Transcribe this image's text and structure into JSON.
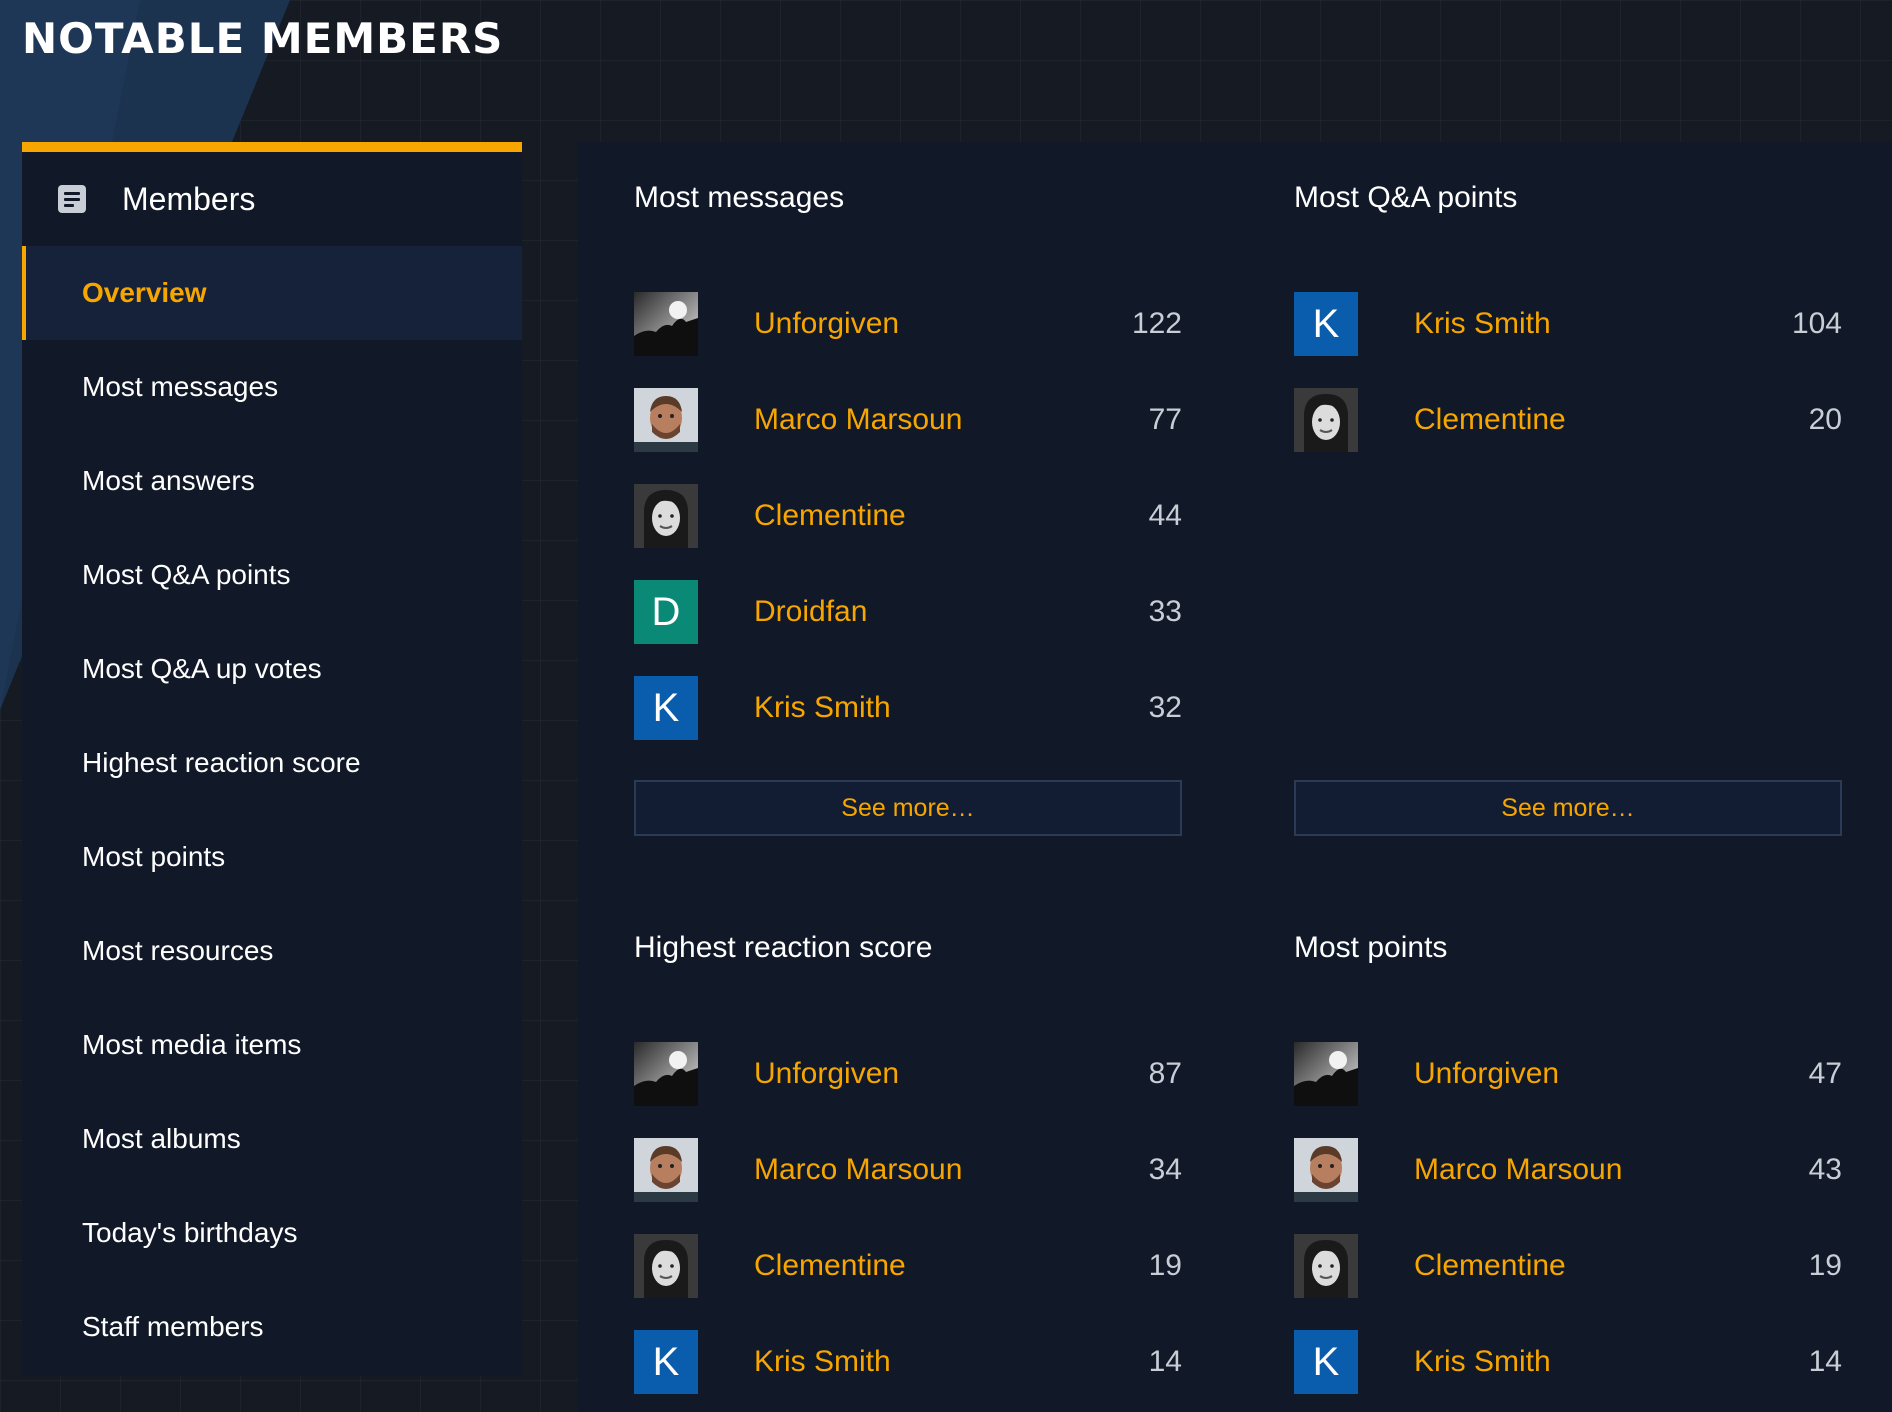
{
  "page": {
    "title": "NOTABLE MEMBERS"
  },
  "sidebar": {
    "title": "Members",
    "icon": "list-icon",
    "items": [
      {
        "label": "Overview",
        "active": true
      },
      {
        "label": "Most messages"
      },
      {
        "label": "Most answers"
      },
      {
        "label": "Most Q&A points"
      },
      {
        "label": "Most Q&A up votes"
      },
      {
        "label": "Highest reaction score"
      },
      {
        "label": "Most points"
      },
      {
        "label": "Most resources"
      },
      {
        "label": "Most media items"
      },
      {
        "label": "Most albums"
      },
      {
        "label": "Today's birthdays"
      },
      {
        "label": "Staff members"
      }
    ]
  },
  "colors": {
    "accent": "#f7a600",
    "background": "#151a23",
    "panel": "#111827",
    "avatar_d": "#0a8a76",
    "avatar_k": "#0a5cad"
  },
  "blocks": [
    {
      "title": "Most messages",
      "see_more": "See more…",
      "members": [
        {
          "name": "Unforgiven",
          "value": "122",
          "avatar": "photo-silhouette"
        },
        {
          "name": "Marco Marsoun",
          "value": "77",
          "avatar": "photo-man"
        },
        {
          "name": "Clementine",
          "value": "44",
          "avatar": "photo-woman"
        },
        {
          "name": "Droidfan",
          "value": "33",
          "avatar": "letter",
          "letter": "D",
          "color": "#0a8a76"
        },
        {
          "name": "Kris Smith",
          "value": "32",
          "avatar": "letter",
          "letter": "K",
          "color": "#0a5cad"
        }
      ]
    },
    {
      "title": "Most Q&A points",
      "see_more": "See more…",
      "members": [
        {
          "name": "Kris Smith",
          "value": "104",
          "avatar": "letter",
          "letter": "K",
          "color": "#0a5cad"
        },
        {
          "name": "Clementine",
          "value": "20",
          "avatar": "photo-woman"
        }
      ]
    },
    {
      "title": "Highest reaction score",
      "members": [
        {
          "name": "Unforgiven",
          "value": "87",
          "avatar": "photo-silhouette"
        },
        {
          "name": "Marco Marsoun",
          "value": "34",
          "avatar": "photo-man"
        },
        {
          "name": "Clementine",
          "value": "19",
          "avatar": "photo-woman"
        },
        {
          "name": "Kris Smith",
          "value": "14",
          "avatar": "letter",
          "letter": "K",
          "color": "#0a5cad"
        }
      ]
    },
    {
      "title": "Most points",
      "members": [
        {
          "name": "Unforgiven",
          "value": "47",
          "avatar": "photo-silhouette"
        },
        {
          "name": "Marco Marsoun",
          "value": "43",
          "avatar": "photo-man"
        },
        {
          "name": "Clementine",
          "value": "19",
          "avatar": "photo-woman"
        },
        {
          "name": "Kris Smith",
          "value": "14",
          "avatar": "letter",
          "letter": "K",
          "color": "#0a5cad"
        }
      ]
    }
  ]
}
